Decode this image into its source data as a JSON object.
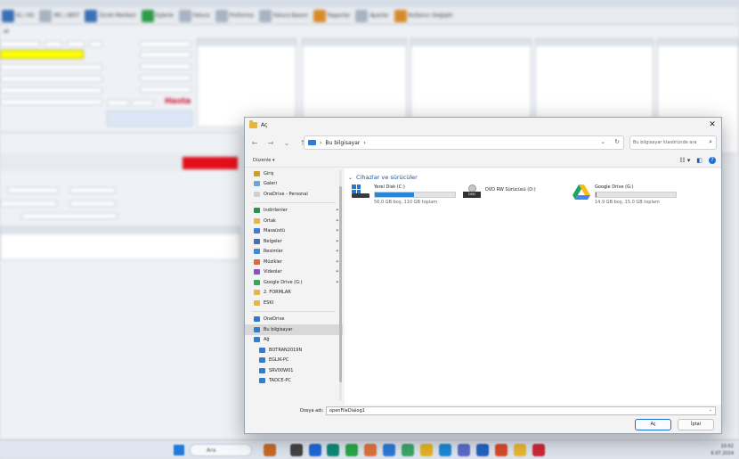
{
  "background_app": {
    "toolbar": [
      {
        "label": "IG / IIG",
        "icon": "doc-icon"
      },
      {
        "label": "IRC / BİST",
        "icon": "chart-icon"
      },
      {
        "label": "Ücret Merkezi",
        "icon": "person-icon"
      },
      {
        "label": "Eşlerle",
        "icon": "people-icon"
      },
      {
        "label": "Fatura",
        "icon": "invoice-icon"
      },
      {
        "label": "Proforma",
        "icon": "proforma-icon"
      },
      {
        "label": "Fatura Basım",
        "icon": "print-icon"
      },
      {
        "label": "Raporlar",
        "icon": "report-icon"
      },
      {
        "label": "Ayarlar",
        "icon": "gear-icon"
      },
      {
        "label": "Kullanıcı Değiştir",
        "icon": "user-switch-icon"
      }
    ],
    "hasta_label": "Hasta",
    "highlight_color": "#ffff00",
    "alert_color": "#e3101c"
  },
  "dialog": {
    "title": "Aç",
    "breadcrumb": "Bu bilgisayar",
    "search_placeholder": "Bu bilgisayar klasöründe ara",
    "organize_label": "Düzenle ▾",
    "nav_items": [
      {
        "label": "Giriş",
        "icon": "home-icon",
        "color": "#c9a227"
      },
      {
        "label": "Galeri",
        "icon": "gallery-icon",
        "color": "#6aa7d8"
      },
      {
        "label": "OneDrive - Personal",
        "icon": "onedrive-icon",
        "color": "#d0d0d0"
      },
      {
        "label": "Indirilenler",
        "icon": "downloads-icon",
        "color": "#2d8f4e",
        "pinned": true
      },
      {
        "label": "Ortak",
        "icon": "folder-icon",
        "color": "#e9b540",
        "pinned": true
      },
      {
        "label": "Masaüstü",
        "icon": "desktop-icon",
        "color": "#3b7dd8",
        "pinned": true
      },
      {
        "label": "Belgeler",
        "icon": "documents-icon",
        "color": "#4a6fb0",
        "pinned": true
      },
      {
        "label": "Resimler",
        "icon": "pictures-icon",
        "color": "#3a8ed8",
        "pinned": true
      },
      {
        "label": "Müzikler",
        "icon": "music-icon",
        "color": "#e0683c",
        "pinned": true
      },
      {
        "label": "Videolar",
        "icon": "videos-icon",
        "color": "#8a4fc9",
        "pinned": true
      },
      {
        "label": "Google Drive (G:)",
        "icon": "google-drive-icon",
        "color": "#34a853",
        "pinned": true
      },
      {
        "label": "2. FORMLAR",
        "icon": "folder-icon",
        "color": "#e9b540"
      },
      {
        "label": "ESKI",
        "icon": "folder-icon",
        "color": "#e9b540"
      }
    ],
    "nav_items_lower": [
      {
        "label": "OneDrive",
        "icon": "onedrive-icon",
        "color": "#2a7bd6"
      },
      {
        "label": "Bu bilgisayar",
        "icon": "pc-icon",
        "color": "#2e7fd0",
        "selected": true
      },
      {
        "label": "Ağ",
        "icon": "network-icon",
        "color": "#2e7fd0"
      },
      {
        "label": "BOTRAN2019N",
        "icon": "computer-icon",
        "color": "#2e7fd0",
        "sub": true
      },
      {
        "label": "EGLIK-PC",
        "icon": "computer-icon",
        "color": "#2e7fd0",
        "sub": true
      },
      {
        "label": "SRV00W01",
        "icon": "computer-icon",
        "color": "#2e7fd0",
        "sub": true
      },
      {
        "label": "TADCE-PC",
        "icon": "computer-icon",
        "color": "#2e7fd0",
        "sub": true
      }
    ],
    "group_title": "Cihazlar ve sürücüler",
    "drives": [
      {
        "name": "Yerel Disk (C:)",
        "free": "56,0 GB boş, 110 GB toplam",
        "used_fraction": 0.49,
        "has_bar": true
      },
      {
        "name": "DVD RW Sürücüsü (D:)",
        "free": "",
        "has_bar": false
      },
      {
        "name": "Google Drive (G:)",
        "free": "14,9 GB boş, 15,0 GB toplam",
        "used_fraction": 0.01,
        "has_bar": true
      }
    ],
    "filename_label": "Dosya adı:",
    "filename_value": "openFileDialog1",
    "open_button": "Aç",
    "cancel_button": "İptal"
  },
  "taskbar": {
    "search_placeholder": "Ara",
    "time": "10:02",
    "date": "6.07.2024"
  }
}
